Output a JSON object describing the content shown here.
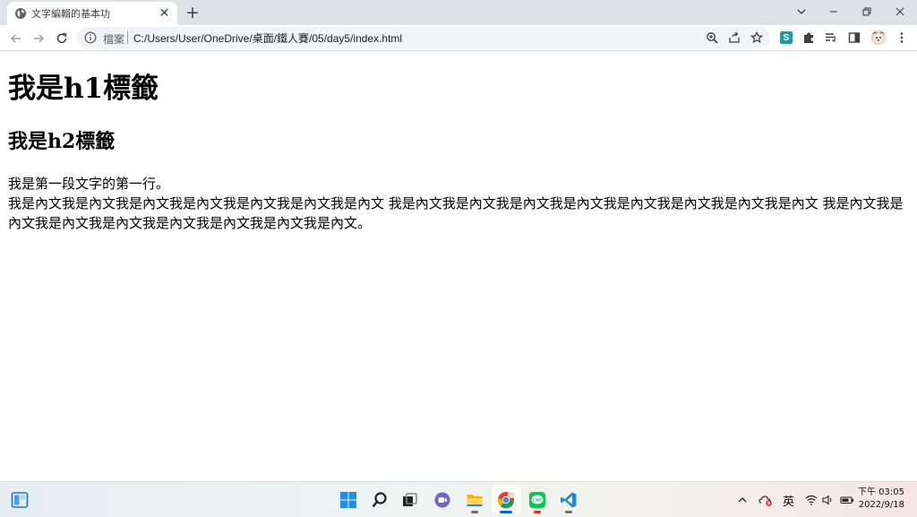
{
  "browser": {
    "tab": {
      "title": "文字編輯的基本功",
      "icon": "globe-icon"
    },
    "address": {
      "prefix": "檔案",
      "url": "C:/Users/User/OneDrive/桌面/鐵人賽/05/day5/index.html"
    },
    "extensions": [
      "s-extension-icon",
      "puzzle-icon",
      "reading-list-icon",
      "side-panel-icon",
      "profile-avatar"
    ],
    "accent": "#1a73e8"
  },
  "page": {
    "h1": "我是h1標籤",
    "h2": "我是h2標籤",
    "paragraph": {
      "line1": "我是第一段文字的第一行。",
      "line2": "我是內文我是內文我是內文我是內文我是內文我是內文我是內文 我是內文我是內文我是內文我是內文我是內文我是內文我是內文我是內文 我是內文我是內文我是內文我是內文我是內文我是內文我是內文我是內文。"
    }
  },
  "taskbar": {
    "apps": [
      "widgets-icon",
      "start-icon",
      "search-icon",
      "task-view-icon",
      "chat-icon",
      "file-explorer-icon",
      "chrome-icon",
      "line-icon",
      "vscode-icon"
    ],
    "tray": {
      "input_language": "英",
      "time": "下午 03:05",
      "date": "2022/9/18"
    }
  }
}
